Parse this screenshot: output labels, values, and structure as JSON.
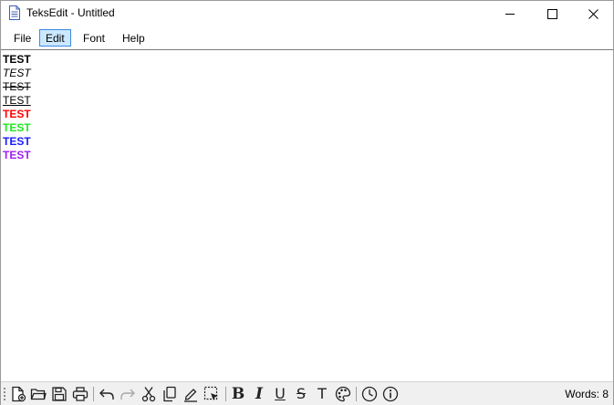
{
  "window": {
    "title": "TeksEdit - Untitled"
  },
  "menu": {
    "items": [
      "File",
      "Edit",
      "Font",
      "Help"
    ],
    "active": "Edit"
  },
  "editor": {
    "lines": [
      {
        "text": "TEST",
        "style": "bold",
        "color": "#000000"
      },
      {
        "text": "TEST",
        "style": "italic",
        "color": "#000000"
      },
      {
        "text": "TEST",
        "style": "strikethrough",
        "color": "#000000"
      },
      {
        "text": "TEST",
        "style": "underline",
        "color": "#000000"
      },
      {
        "text": "TEST",
        "style": "bold",
        "color": "#ff0000"
      },
      {
        "text": "TEST",
        "style": "bold",
        "color": "#22e622"
      },
      {
        "text": "TEST",
        "style": "bold",
        "color": "#1a1aff"
      },
      {
        "text": "TEST",
        "style": "bold",
        "color": "#a020f0"
      }
    ]
  },
  "toolbar": {
    "icons": [
      "new-file-icon",
      "open-folder-icon",
      "save-icon",
      "print-icon",
      "undo-icon",
      "redo-icon",
      "cut-icon",
      "copy-icon",
      "paste-icon",
      "select-all-icon",
      "bold-icon",
      "italic-icon",
      "underline-icon",
      "strikethrough-icon",
      "font-icon",
      "color-palette-icon",
      "clock-icon",
      "info-icon"
    ],
    "bold_glyph": "B",
    "italic_glyph": "I",
    "underline_glyph": "U",
    "strike_glyph": "S",
    "font_glyph": "T"
  },
  "status": {
    "word_count": "Words: 8"
  }
}
